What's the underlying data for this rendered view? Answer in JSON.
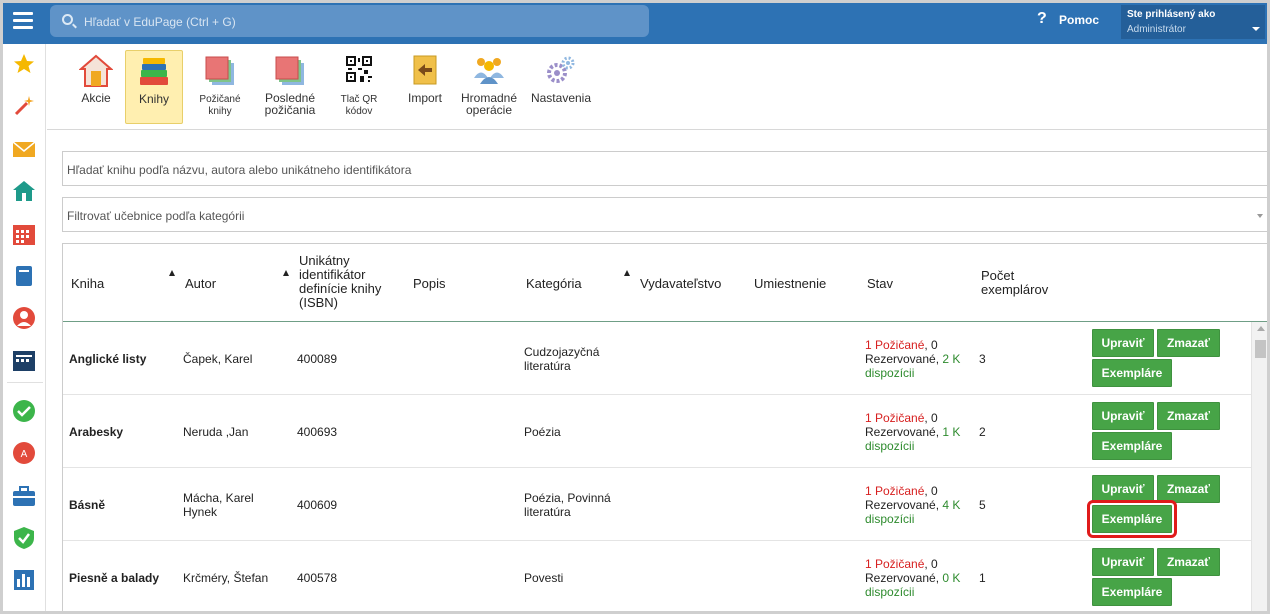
{
  "topbar": {
    "search_placeholder": "Hľadať v EduPage (Ctrl + G)",
    "help_label": "Pomoc",
    "user_line1": "Ste prihlásený ako",
    "user_line2": "Administrátor"
  },
  "sidebar": {
    "icons": [
      "star-icon",
      "magic-wand-icon",
      "envelope-icon",
      "home-icon",
      "calendar-grid-icon",
      "book-icon",
      "person-icon",
      "clock-calendar-icon",
      "check-circle-icon",
      "red-badge-icon",
      "briefcase-icon",
      "shield-check-icon",
      "bar-chart-icon"
    ]
  },
  "toolbar": {
    "items": [
      {
        "label": "Akcie",
        "icon": "door-house-icon"
      },
      {
        "label": "Knihy",
        "icon": "stacked-books-icon"
      },
      {
        "label": "Požičané knihy",
        "icon": "red-stack-icon"
      },
      {
        "label": "Posledné požičania",
        "icon": "red-stack-icon"
      },
      {
        "label": "Tlač QR kódov",
        "icon": "qr-code-icon"
      },
      {
        "label": "Import",
        "icon": "import-arrow-icon"
      },
      {
        "label": "Hromadné operácie",
        "icon": "group-people-icon"
      },
      {
        "label": "Nastavenia",
        "icon": "gears-icon"
      }
    ]
  },
  "filters": {
    "search_placeholder": "Hľadať knihu podľa názvu, autora alebo unikátneho identifikátora",
    "category_placeholder": "Filtrovať učebnice podľa kategórii"
  },
  "table": {
    "headers": {
      "kniha": "Kniha",
      "autor": "Autor",
      "isbn": "Unikátny identifikátor definície knihy (ISBN)",
      "popis": "Popis",
      "kategoria": "Kategória",
      "vydavatelstvo": "Vydavateľstvo",
      "umiestnenie": "Umiestnenie",
      "stav": "Stav",
      "pocet": "Počet exemplárov"
    },
    "buttons": {
      "edit": "Upraviť",
      "delete": "Zmazať",
      "copies": "Exempláre"
    },
    "rows": [
      {
        "title": "Anglické listy",
        "author": "Čapek, Karel",
        "isbn": "400089",
        "category": "Cudzojazyčná literatúra",
        "borrowed": "1 Požičané",
        "s1": ", 0",
        "s2": "Rezervované, ",
        "available": "2 K",
        "s3": "dispozícii",
        "count": "3"
      },
      {
        "title": "Arabesky",
        "author": "Neruda ,Jan",
        "isbn": "400693",
        "category": "Poézia",
        "borrowed": "1 Požičané",
        "s1": ", 0",
        "s2": "Rezervované, ",
        "available": "1 K",
        "s3": "dispozícii",
        "count": "2"
      },
      {
        "title": "Básně",
        "author": "Mácha, Karel Hynek",
        "isbn": "400609",
        "category": "Poézia, Povinná literatúra",
        "borrowed": "1 Požičané",
        "s1": ", 0",
        "s2": "Rezervované, ",
        "available": "4 K",
        "s3": "dispozícii",
        "count": "5"
      },
      {
        "title": "Piesně a balady",
        "author": "Krčméry, Štefan",
        "isbn": "400578",
        "category": "Povesti",
        "borrowed": "1 Požičané",
        "s1": ", 0",
        "s2": "Rezervované, ",
        "available": "0 K",
        "s3": "dispozícii",
        "count": "1"
      }
    ],
    "highlighted_row_index": 2
  }
}
